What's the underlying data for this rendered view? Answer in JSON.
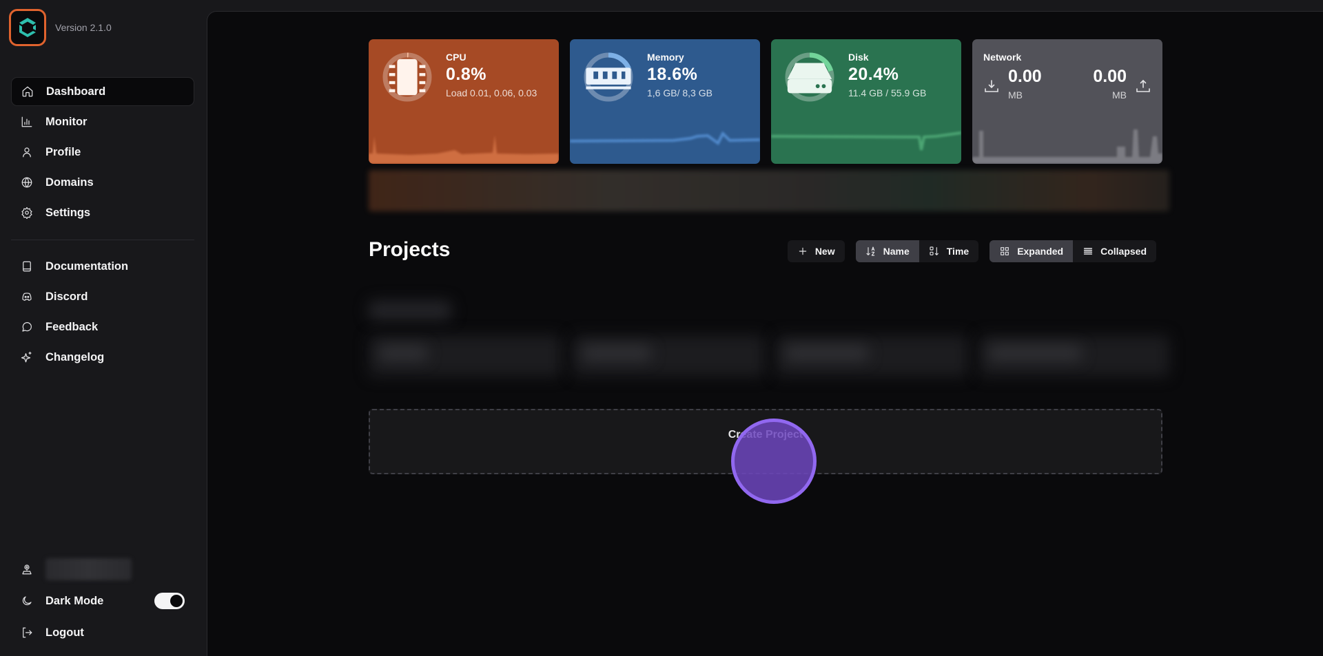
{
  "app": {
    "version": "Version 2.1.0",
    "logo_icon": "hexagon-logo-icon",
    "brand_colors": {
      "logo_border": "#e0632e",
      "logo_mark": "#2ebfae"
    }
  },
  "sidebar": {
    "primary": [
      {
        "label": "Dashboard",
        "icon": "home-icon",
        "active": true
      },
      {
        "label": "Monitor",
        "icon": "bar-chart-icon"
      },
      {
        "label": "Profile",
        "icon": "user-icon"
      },
      {
        "label": "Domains",
        "icon": "globe-icon"
      },
      {
        "label": "Settings",
        "icon": "gear-icon"
      }
    ],
    "secondary": [
      {
        "label": "Documentation",
        "icon": "book-icon"
      },
      {
        "label": "Discord",
        "icon": "discord-icon"
      },
      {
        "label": "Feedback",
        "icon": "message-circle-icon"
      },
      {
        "label": "Changelog",
        "icon": "sparkles-icon"
      }
    ],
    "bottom": {
      "user_icon": "user-pin-icon",
      "user_name": "",
      "dark_mode_label": "Dark Mode",
      "dark_mode_on": true,
      "logout_label": "Logout"
    }
  },
  "stats": {
    "cpu": {
      "label": "CPU",
      "value": "0.8%",
      "percent": 0.8,
      "sub": "Load 0.01, 0.06, 0.03",
      "color": "#a64a25",
      "icon": "cpu-chip-icon"
    },
    "memory": {
      "label": "Memory",
      "value": "18.6%",
      "percent": 18.6,
      "sub": "1,6 GB/ 8,3 GB",
      "color": "#2e5a8e",
      "icon": "memory-ram-icon"
    },
    "disk": {
      "label": "Disk",
      "value": "20.4%",
      "percent": 20.4,
      "sub": "11.4 GB / 55.9 GB",
      "color": "#2a7350",
      "icon": "hard-drive-icon"
    },
    "network": {
      "label": "Network",
      "download_value": "0.00",
      "download_unit": "MB",
      "download_icon": "download-icon",
      "upload_value": "0.00",
      "upload_unit": "MB",
      "upload_icon": "upload-icon",
      "color": "#525259"
    }
  },
  "projects": {
    "title": "Projects",
    "new_label": "New",
    "sort": [
      {
        "label": "Name",
        "icon": "sort-alpha-icon",
        "active": true
      },
      {
        "label": "Time",
        "icon": "sort-time-icon",
        "active": false
      }
    ],
    "view": [
      {
        "label": "Expanded",
        "icon": "grid-icon",
        "active": true
      },
      {
        "label": "Collapsed",
        "icon": "list-icon",
        "active": false
      }
    ],
    "create_label": "Create Project"
  }
}
